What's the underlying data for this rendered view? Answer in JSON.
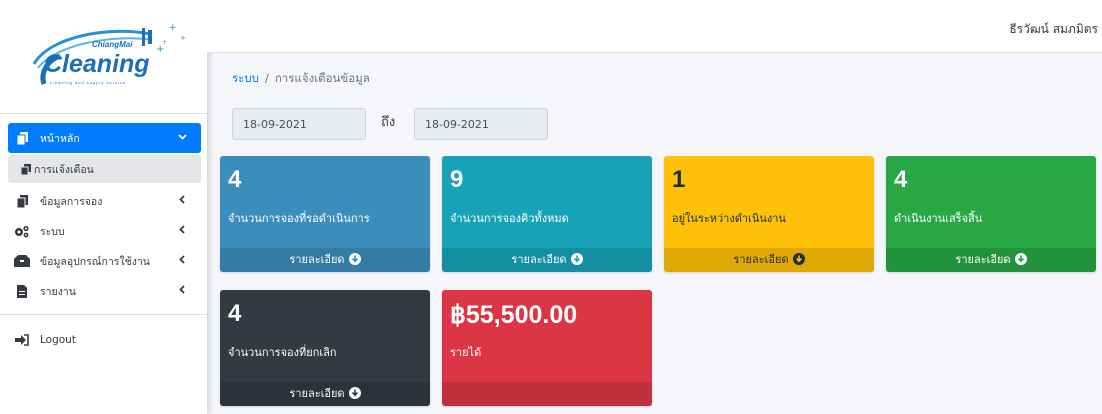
{
  "brand": {
    "logo_small_text": "ChiangMai",
    "logo_main_text": "Cleaning",
    "logo_tagline": "cleaning and supply service"
  },
  "header": {
    "user_name": "ธีรวัฒน์ สมภมิตร"
  },
  "sidebar": {
    "items": [
      {
        "label": "หน้าหลัก",
        "icon": "copy-icon",
        "expanded": true
      },
      {
        "label": "การแจ้งเตือน",
        "icon": "copy-icon"
      },
      {
        "label": "ข้อมูลการจอง",
        "icon": "copy-icon"
      },
      {
        "label": "ระบบ",
        "icon": "cogs-icon"
      },
      {
        "label": "ข้อมูลอุปกรณ์การใช้งาน",
        "icon": "toolbox-icon"
      },
      {
        "label": "รายงาน",
        "icon": "file-icon"
      }
    ],
    "logout_label": "Logout"
  },
  "breadcrumb": {
    "root": "ระบบ",
    "separator": "/",
    "current": "การแจ้งเตือนข้อมูล"
  },
  "date_range": {
    "from": "18-09-2021",
    "to_label": "ถึง",
    "to": "18-09-2021"
  },
  "stats": [
    {
      "value": "4",
      "label": "จำนวนการจองที่รอดำเนินการ",
      "footer": "รายละเอียด",
      "color": "#3c8dbc"
    },
    {
      "value": "9",
      "label": "จำนวนการจองคิวทั้งหมด",
      "footer": "รายละเอียด",
      "color": "#17a2b8"
    },
    {
      "value": "1",
      "label": "อยู่ในระหว่างดำเนินงาน",
      "footer": "รายละเอียด",
      "color": "#ffc107"
    },
    {
      "value": "4",
      "label": "ดำเนินงานเสร็จสิ้น",
      "footer": "รายละเอียด",
      "color": "#28a745"
    },
    {
      "value": "4",
      "label": "จำนวนการจองที่ยกเลิก",
      "footer": "รายละเอียด",
      "color": "#343a40"
    },
    {
      "value": "฿55,500.00",
      "label": "รายได้",
      "footer": "",
      "color": "#dc3545"
    }
  ]
}
